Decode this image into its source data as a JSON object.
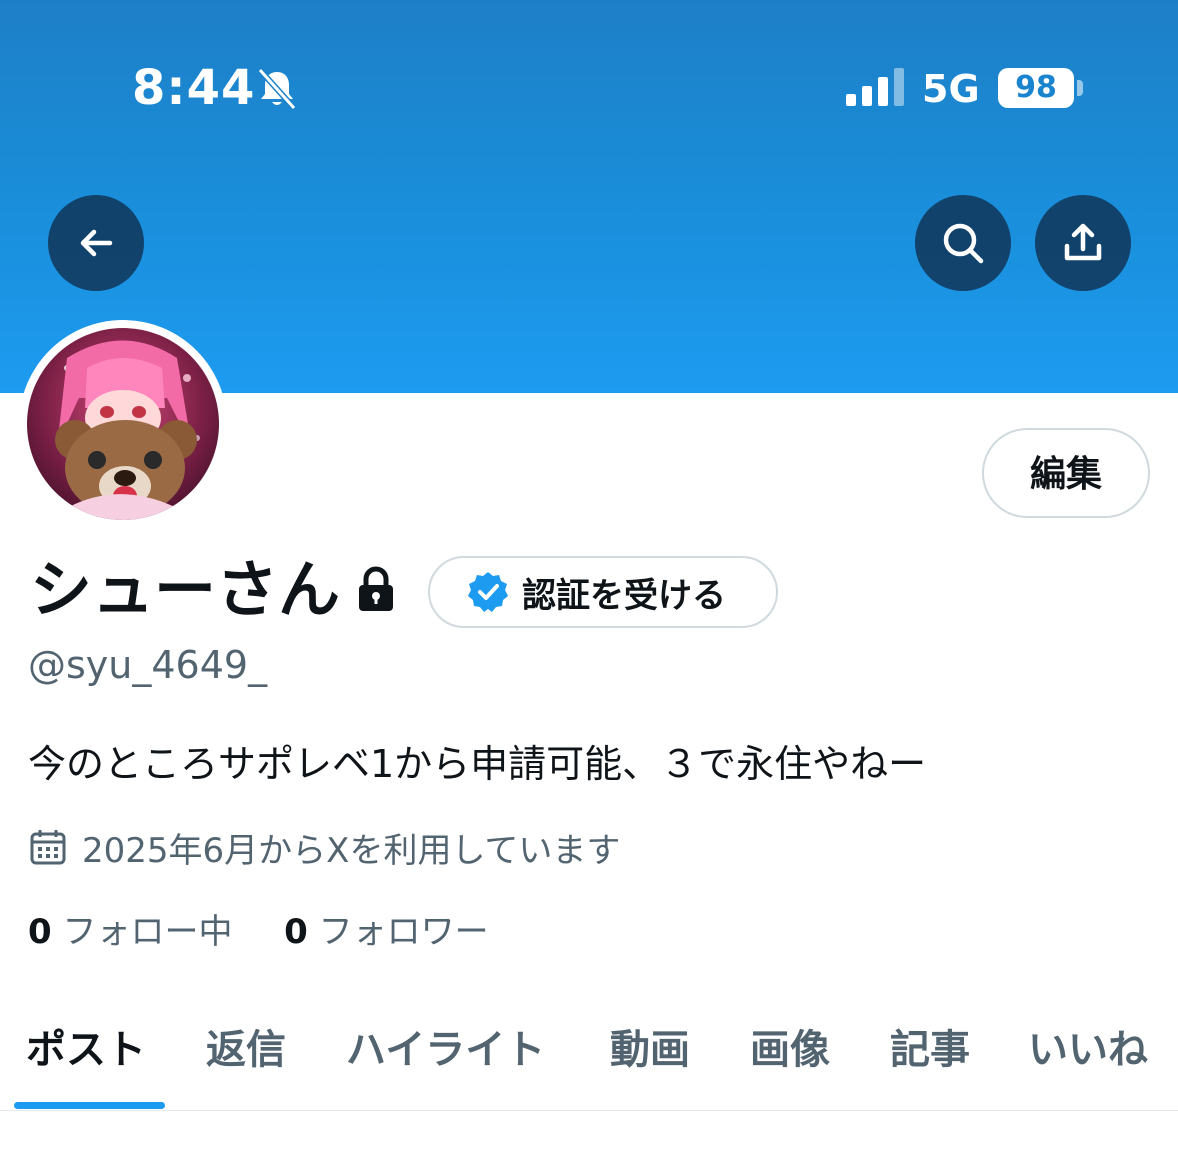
{
  "status_bar": {
    "time": "8:44",
    "network": "5G",
    "battery": "98"
  },
  "header": {
    "back_icon": "arrow-left-icon",
    "search_icon": "search-icon",
    "share_icon": "share-icon"
  },
  "profile": {
    "edit_label": "編集",
    "display_name": "シューさん",
    "verify_label": "認証を受ける",
    "handle": "@syu_4649_",
    "bio": "今のところサポレベ1から申請可能、３で永住やねー",
    "joined": "2025年6月からXを利用しています",
    "following_count": "0",
    "following_label": "フォロー中",
    "followers_count": "0",
    "followers_label": "フォロワー"
  },
  "tabs": [
    {
      "label": "ポスト",
      "active": true
    },
    {
      "label": "返信"
    },
    {
      "label": "ハイライト"
    },
    {
      "label": "動画"
    },
    {
      "label": "画像"
    },
    {
      "label": "記事"
    },
    {
      "label": "いいね"
    }
  ],
  "colors": {
    "accent": "#1d9bf0",
    "banner": "#1a8fdb",
    "secondary_text": "#536471"
  }
}
